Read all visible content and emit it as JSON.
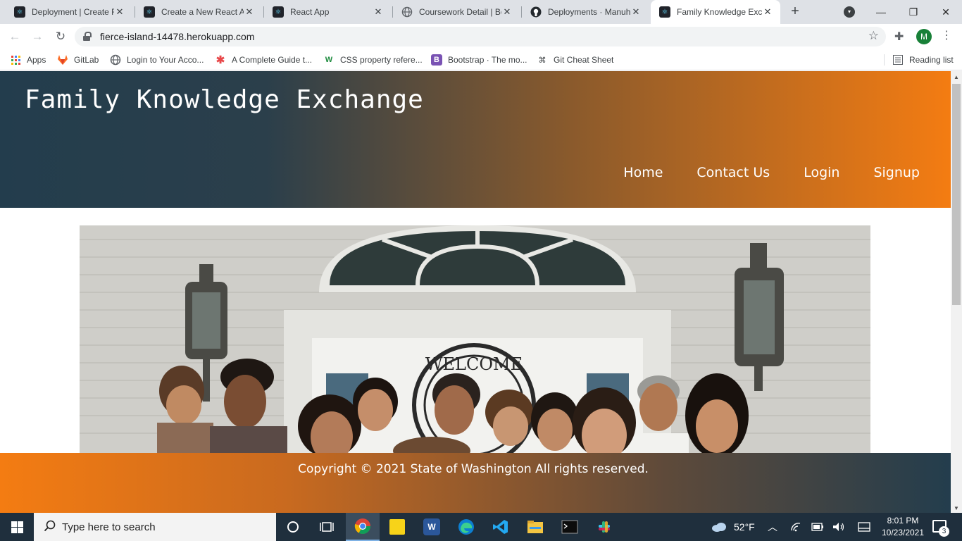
{
  "browser": {
    "tabs": [
      {
        "title": "Deployment | Create R",
        "icon": "react-icon",
        "active": false
      },
      {
        "title": "Create a New React Ap",
        "icon": "react-icon",
        "active": false
      },
      {
        "title": "React App",
        "icon": "react-icon",
        "active": false
      },
      {
        "title": "Coursework Detail | Bc",
        "icon": "globe-icon",
        "active": false
      },
      {
        "title": "Deployments · Manuh",
        "icon": "github-icon",
        "active": false
      },
      {
        "title": "Family Knowledge Exc",
        "icon": "react-icon",
        "active": true
      }
    ],
    "close_glyph": "✕",
    "new_tab_glyph": "+",
    "url": "fierce-island-14478.herokuapp.com",
    "profile_initial": "M",
    "bookmarks": [
      {
        "label": "Apps",
        "icon": "apps-grid-icon"
      },
      {
        "label": "GitLab",
        "icon": "gitlab-icon"
      },
      {
        "label": "Login to Your Acco...",
        "icon": "globe-icon"
      },
      {
        "label": "A Complete Guide t...",
        "icon": "css-tricks-icon"
      },
      {
        "label": "CSS property refere...",
        "icon": "w3-icon"
      },
      {
        "label": "Bootstrap · The mo...",
        "icon": "bootstrap-icon"
      },
      {
        "label": "Git Cheat Sheet",
        "icon": "command-icon"
      }
    ],
    "reading_list": "Reading list"
  },
  "site": {
    "title": "Family Knowledge Exchange",
    "nav": [
      "Home",
      "Contact Us",
      "Login",
      "Signup"
    ],
    "hero_alt": "Family photo in front of a house with a Welcome sign",
    "hero_sign": "WELCOME",
    "footer": "Copyright © 2021  State of Washington  All rights reserved."
  },
  "taskbar": {
    "search_placeholder": "Type here to search",
    "weather": "52°F",
    "time": "8:01 PM",
    "date": "10/23/2021",
    "notification_count": "3"
  },
  "colors": {
    "header_dark": "#233d4d",
    "header_orange": "#f47c12",
    "taskbar": "#1f2f3d"
  }
}
